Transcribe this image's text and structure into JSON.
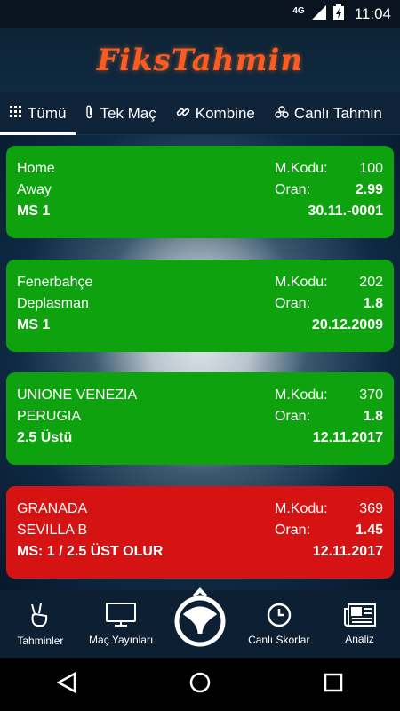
{
  "status": {
    "network": "4G",
    "time": "11:04"
  },
  "header": {
    "logo": "FiksTahmin"
  },
  "tabs": [
    {
      "label": "Tümü",
      "icon": "grid-icon"
    },
    {
      "label": "Tek Maç",
      "icon": "paperclip-icon"
    },
    {
      "label": "Kombine",
      "icon": "link-icon"
    },
    {
      "label": "Canlı Tahmin",
      "icon": "three-circles-icon"
    }
  ],
  "cards": [
    {
      "home": "Home",
      "away": "Away",
      "pick": "MS 1",
      "code_label": "M.Kodu:",
      "code": "100",
      "odds_label": "Oran:",
      "odds": "2.99",
      "date": "30.11.-0001",
      "color": "#0ea20e"
    },
    {
      "home": "Fenerbahçe",
      "away": "Deplasman",
      "pick": "MS 1",
      "code_label": "M.Kodu:",
      "code": "202",
      "odds_label": "Oran:",
      "odds": "1.8",
      "date": "20.12.2009",
      "color": "#0ea20e"
    },
    {
      "home": "UNIONE VENEZIA",
      "away": "PERUGIA",
      "pick": "2.5 Üstü",
      "code_label": "M.Kodu:",
      "code": "370",
      "odds_label": "Oran:",
      "odds": "1.8",
      "date": "12.11.2017",
      "color": "#0ea20e"
    },
    {
      "home": "GRANADA",
      "away": "SEVILLA B",
      "pick": "MS: 1 / 2.5 ÜST OLUR",
      "code_label": "M.Kodu:",
      "code": "369",
      "odds_label": "Oran:",
      "odds": "1.45",
      "date": "12.11.2017",
      "color": "#d61313"
    }
  ],
  "bottomnav": [
    {
      "label": "Tahminler",
      "icon": "hand-peace-icon"
    },
    {
      "label": "Maç Yayınları",
      "icon": "tv-icon"
    },
    {
      "label": "",
      "icon": "club-logo-icon"
    },
    {
      "label": "Canlı Skorlar",
      "icon": "clock-icon"
    },
    {
      "label": "Analiz",
      "icon": "newspaper-icon"
    }
  ]
}
